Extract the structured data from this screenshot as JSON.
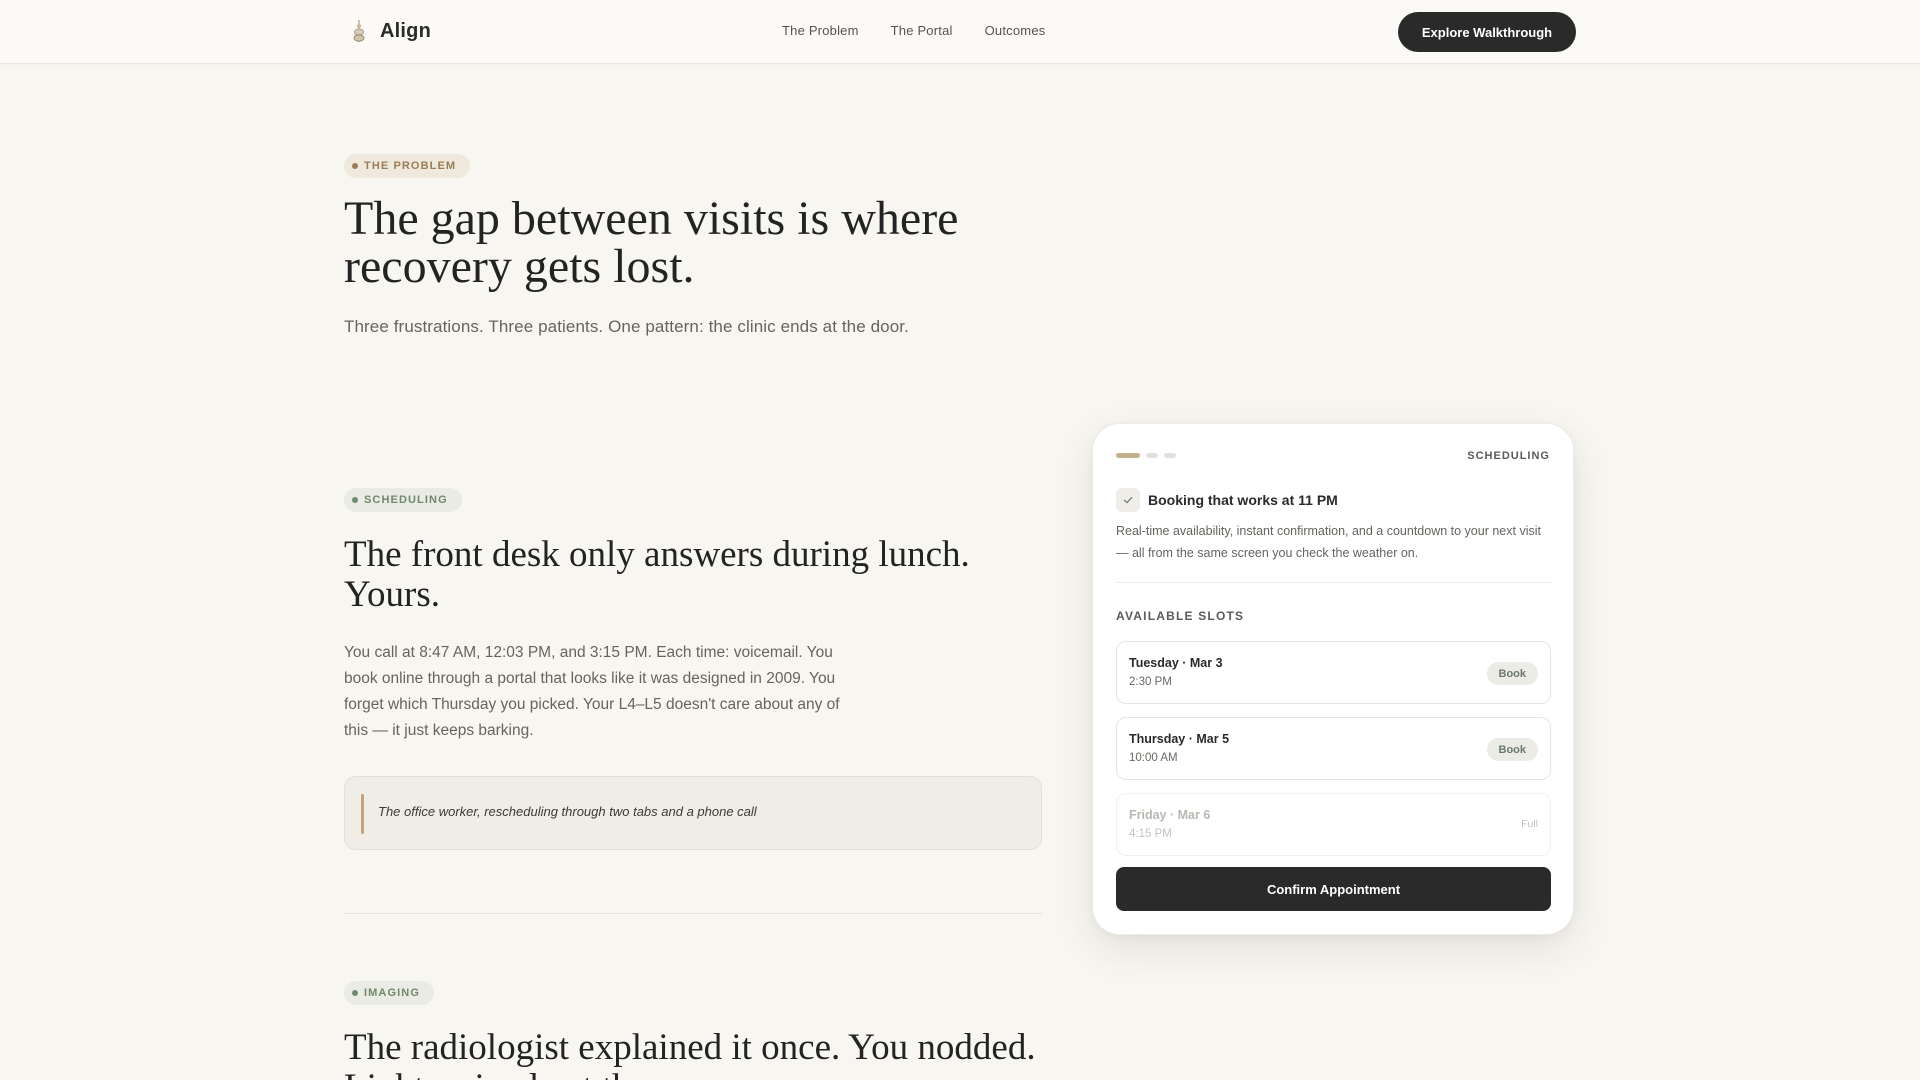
{
  "nav": {
    "brand": "Align",
    "links": [
      "The Problem",
      "The Portal",
      "Outcomes"
    ],
    "cta": "Explore Walkthrough"
  },
  "hero": {
    "pill": "THE PROBLEM",
    "title": "The gap between visits is where recovery gets lost.",
    "subtitle": "Three frustrations. Three patients. One pattern: the clinic ends at the door."
  },
  "scheduling": {
    "pill": "SCHEDULING",
    "title": "The front desk only answers during lunch. Yours.",
    "body": "You call at 8:47 AM, 12:03 PM, and 3:15 PM. Each time: voicemail. You book online through a portal that looks like it was designed in 2009. You forget which Thursday you picked. Your L4–L5 doesn't care about any of this — it just keeps barking.",
    "quote": "The office worker, rescheduling through two tabs and a phone call"
  },
  "imaging": {
    "pill": "IMAGING",
    "title": "The radiologist explained it once. You nodded. Light arrived yet the"
  },
  "card": {
    "label": "SCHEDULING",
    "progress_step": 1,
    "progress_total": 3,
    "feature_title": "Booking that works at 11 PM",
    "feature_desc": "Real-time availability, instant confirmation, and a countdown to your next visit — all from the same screen you check the weather on.",
    "slots_label": "AVAILABLE SLOTS",
    "slots": [
      {
        "day": "Tuesday · Mar 3",
        "time": "2:30 PM",
        "action": "Book"
      },
      {
        "day": "Thursday · Mar 5",
        "time": "10:00 AM",
        "action": "Book"
      },
      {
        "day": "Friday · Mar 6",
        "time": "4:15 PM",
        "status": "Full"
      }
    ],
    "confirm": "Confirm Appointment"
  },
  "colors": {
    "background": "#f8f6f1",
    "accent_gold": "#c2a277",
    "accent_green": "#6f8a6c",
    "dark": "#2a2a2a"
  }
}
